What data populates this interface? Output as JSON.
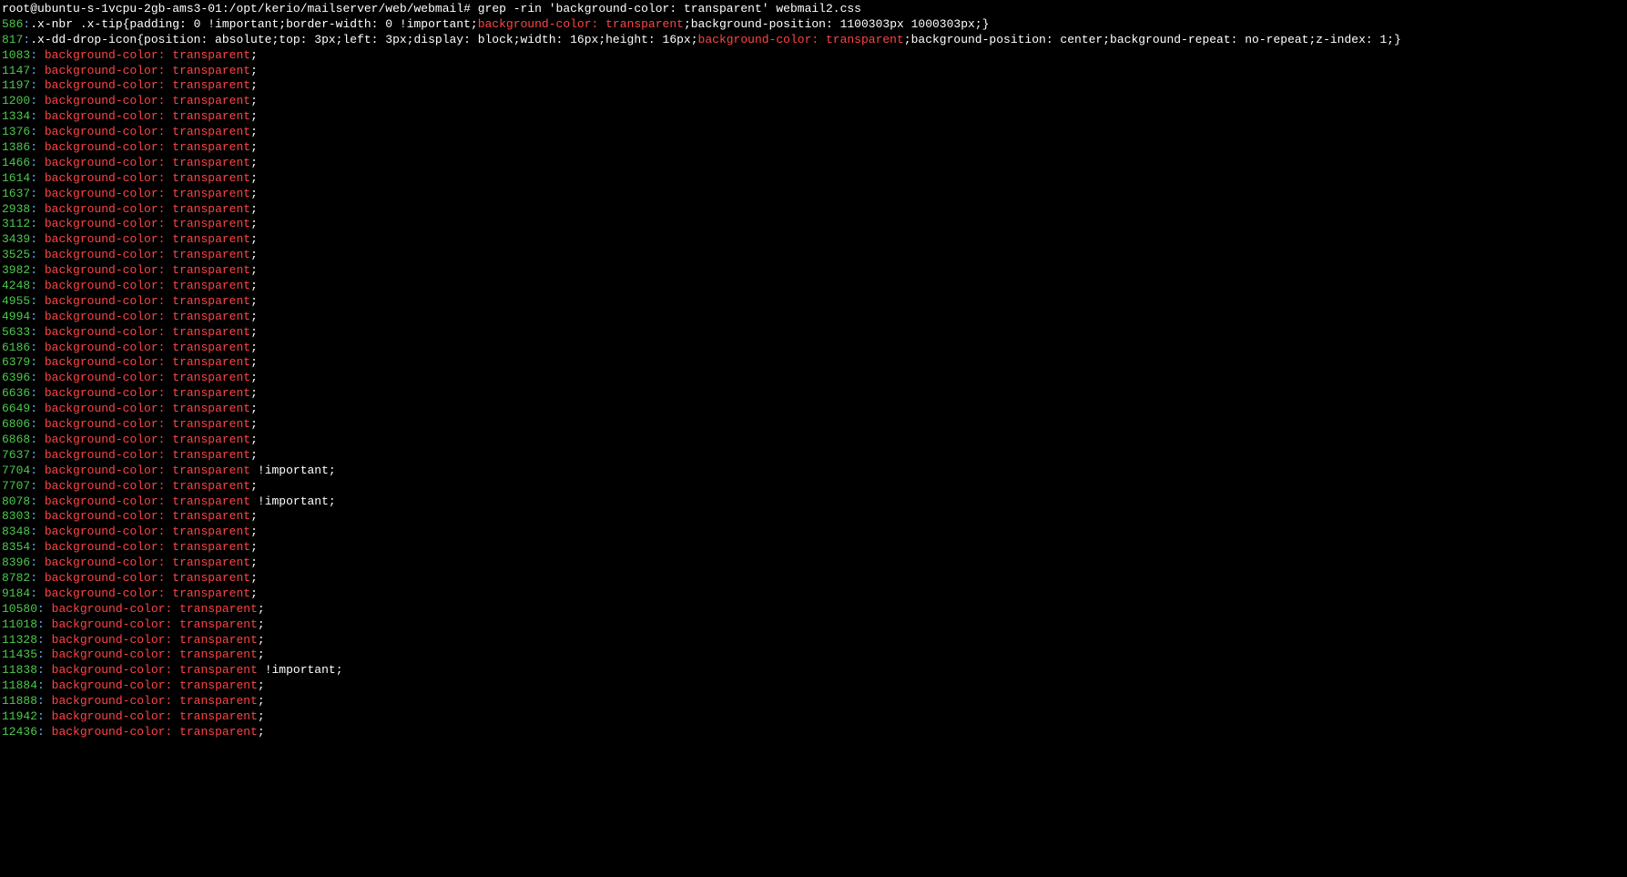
{
  "prompt": {
    "user_host": "root@ubuntu-s-1vcpu-2gb-ams3-01",
    "path": "/opt/kerio/mailserver/web/webmail",
    "symbol": "#",
    "command": "grep -rin 'background-color: transparent' webmail2.css"
  },
  "match_text": "background-color: transparent",
  "inline_lines": [
    {
      "num": "586",
      "before": ":.x-nbr .x-tip{padding: 0 !important;border-width: 0 !important;",
      "after": ";background-position: 1100303px 1000303px;}"
    },
    {
      "num": "817",
      "before": ":.x-dd-drop-icon{position: absolute;top: 3px;left: 3px;display: block;width: 16px;height: 16px;",
      "after": ";background-position: center;background-repeat: no-repeat;z-index: 1;}"
    }
  ],
  "simple_lines": [
    {
      "num": "1083",
      "suffix": ";"
    },
    {
      "num": "1147",
      "suffix": ";"
    },
    {
      "num": "1197",
      "suffix": ";"
    },
    {
      "num": "1200",
      "suffix": ";"
    },
    {
      "num": "1334",
      "suffix": ";"
    },
    {
      "num": "1376",
      "suffix": ";"
    },
    {
      "num": "1386",
      "suffix": ";"
    },
    {
      "num": "1466",
      "suffix": ";"
    },
    {
      "num": "1614",
      "suffix": ";"
    },
    {
      "num": "1637",
      "suffix": ";"
    },
    {
      "num": "2938",
      "suffix": ";"
    },
    {
      "num": "3112",
      "suffix": ";"
    },
    {
      "num": "3439",
      "suffix": ";"
    },
    {
      "num": "3525",
      "suffix": ";"
    },
    {
      "num": "3982",
      "suffix": ";"
    },
    {
      "num": "4248",
      "suffix": ";"
    },
    {
      "num": "4955",
      "suffix": ";"
    },
    {
      "num": "4994",
      "suffix": ";"
    },
    {
      "num": "5633",
      "suffix": ";"
    },
    {
      "num": "6186",
      "suffix": ";"
    },
    {
      "num": "6379",
      "suffix": ";"
    },
    {
      "num": "6396",
      "suffix": ";"
    },
    {
      "num": "6636",
      "suffix": ";"
    },
    {
      "num": "6649",
      "suffix": ";"
    },
    {
      "num": "6806",
      "suffix": ";"
    },
    {
      "num": "6868",
      "suffix": ";"
    },
    {
      "num": "7637",
      "suffix": ";"
    },
    {
      "num": "7704",
      "suffix": " !important;"
    },
    {
      "num": "7707",
      "suffix": ";"
    },
    {
      "num": "8078",
      "suffix": " !important;"
    },
    {
      "num": "8303",
      "suffix": ";"
    },
    {
      "num": "8348",
      "suffix": ";"
    },
    {
      "num": "8354",
      "suffix": ";"
    },
    {
      "num": "8396",
      "suffix": ";"
    },
    {
      "num": "8782",
      "suffix": ";"
    },
    {
      "num": "9184",
      "suffix": ";"
    },
    {
      "num": "10580",
      "suffix": ";"
    },
    {
      "num": "11018",
      "suffix": ";"
    },
    {
      "num": "11328",
      "suffix": ";"
    },
    {
      "num": "11435",
      "suffix": ";"
    },
    {
      "num": "11838",
      "suffix": " !important;"
    },
    {
      "num": "11884",
      "suffix": ";"
    },
    {
      "num": "11888",
      "suffix": ";"
    },
    {
      "num": "11942",
      "suffix": ";"
    },
    {
      "num": "12436",
      "suffix": ";"
    }
  ]
}
